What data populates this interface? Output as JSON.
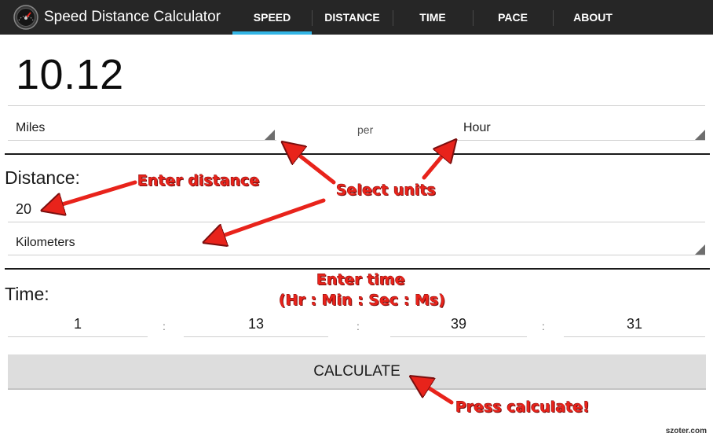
{
  "app": {
    "title": "Speed Distance Calculator"
  },
  "tabs": [
    {
      "label": "SPEED",
      "selected": true
    },
    {
      "label": "DISTANCE",
      "selected": false
    },
    {
      "label": "TIME",
      "selected": false
    },
    {
      "label": "PACE",
      "selected": false
    },
    {
      "label": "ABOUT",
      "selected": false
    }
  ],
  "result": {
    "value": "10.12"
  },
  "speed_units": {
    "distance_unit": "Miles",
    "per_label": "per",
    "time_unit": "Hour"
  },
  "distance": {
    "label": "Distance:",
    "value": "20",
    "unit": "Kilometers"
  },
  "time": {
    "label": "Time:",
    "hours": "1",
    "minutes": "13",
    "seconds": "39",
    "ms": "31",
    "separator": ":"
  },
  "calculate_button": {
    "label": "CALCULATE"
  },
  "annotations": {
    "enter_distance": "Enter distance",
    "select_units": "Select units",
    "enter_time_line1": "Enter time",
    "enter_time_line2": "(Hr : Min : Sec : Ms)",
    "press_calculate": "Press calculate!"
  },
  "watermark": "szoter.com",
  "colors": {
    "accent": "#33b5e5",
    "actionbar": "#262626",
    "annotation": "#e8231b"
  },
  "icons": {
    "app_icon": "speedometer-icon"
  }
}
